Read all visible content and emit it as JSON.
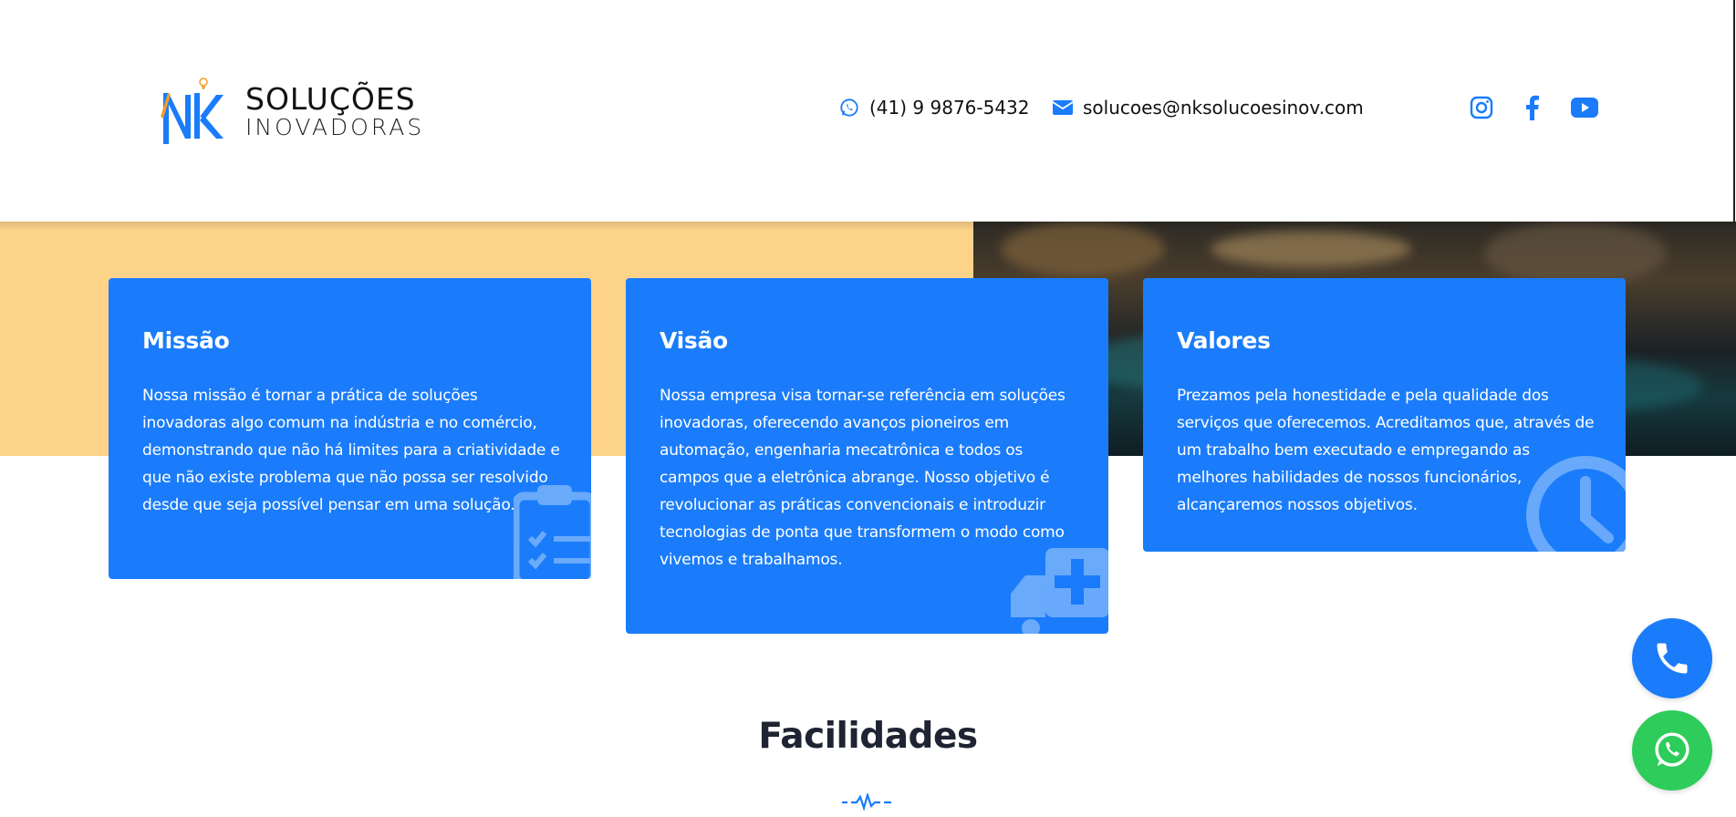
{
  "header": {
    "logo": {
      "line1": "SOLUÇÕES",
      "line2": "INOVADORAS",
      "mark": "NK"
    },
    "phone": "(41) 9 9876-5432",
    "email": "solucoes@nksolucoesinov.com",
    "social": [
      "instagram-icon",
      "facebook-icon",
      "youtube-icon"
    ]
  },
  "cards": [
    {
      "title": "Missão",
      "text": "Nossa missão é tornar a prática de soluções inovadoras algo comum na indústria e no comércio, demonstrando que não há limites para a criatividade e que não existe problema que não possa ser resolvido desde que seja possível pensar em uma solução.",
      "icon": "clipboard-icon"
    },
    {
      "title": "Visão",
      "text": "Nossa empresa visa tornar-se referência em soluções inovadoras, oferecendo avanços pioneiros em automação, engenharia mecatrônica e todos os campos que a eletrônica abrange. Nosso objetivo é revolucionar as práticas convencionais e introduzir tecnologias de ponta que transformem o modo como vivemos e trabalhamos.",
      "icon": "ambulance-icon"
    },
    {
      "title": "Valores",
      "text": "Prezamos pela honestidade e pela qualidade dos serviços que oferecemos. Acreditamos que, através de um trabalho bem executado e empregando as melhores habilidades de nossos funcionários, alcançaremos nossos objetivos.",
      "icon": "clock-icon"
    }
  ],
  "section": {
    "title": "Facilidades"
  },
  "colors": {
    "primary": "#1a7cfa",
    "band": "#fdd38a",
    "whatsapp": "#2ecc5a",
    "heading": "#1f2433"
  }
}
